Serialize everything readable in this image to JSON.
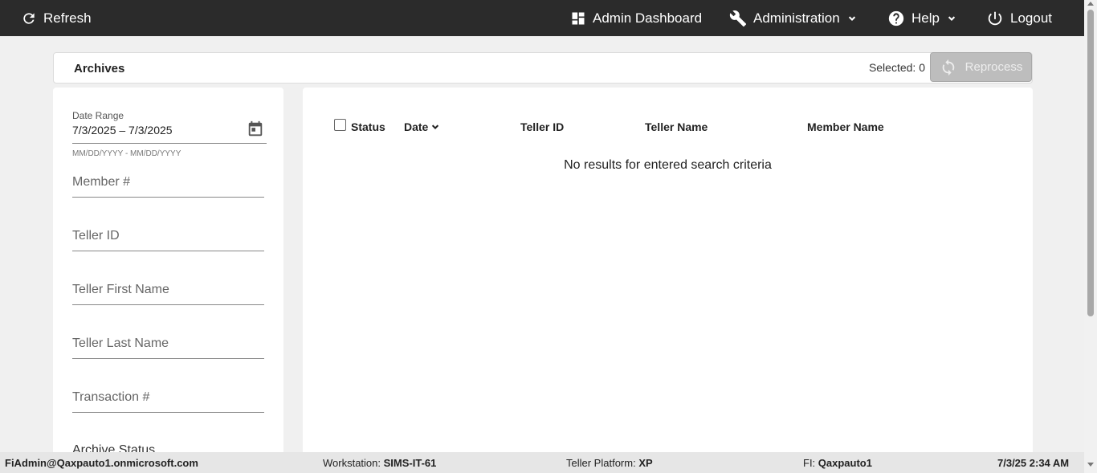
{
  "nav": {
    "refresh": "Refresh",
    "admin_dashboard": "Admin Dashboard",
    "administration": "Administration",
    "help": "Help",
    "logout": "Logout"
  },
  "header": {
    "title": "Archives",
    "selected_label": "Selected: 0",
    "reprocess_label": "Reprocess"
  },
  "filters": {
    "date_range_label": "Date Range",
    "date_range_value": "7/3/2025 – 7/3/2025",
    "date_hint": "MM/DD/YYYY - MM/DD/YYYY",
    "member_placeholder": "Member #",
    "teller_id_placeholder": "Teller ID",
    "teller_first_placeholder": "Teller First Name",
    "teller_last_placeholder": "Teller Last Name",
    "transaction_placeholder": "Transaction #",
    "archive_status_label": "Archive Status"
  },
  "table": {
    "columns": [
      "Status",
      "Date",
      "Teller ID",
      "Teller Name",
      "Member Name"
    ],
    "empty_message": "No results for entered search criteria"
  },
  "footer": {
    "user": "FiAdmin@Qaxpauto1.onmicrosoft.com",
    "workstation_label": "Workstation: ",
    "workstation_value": "SIMS-IT-61",
    "platform_label": "Teller Platform: ",
    "platform_value": "XP",
    "fi_label": "FI: ",
    "fi_value": "Qaxpauto1",
    "datetime": "7/3/25 2:34 AM"
  },
  "icons": {
    "refresh": "refresh-icon",
    "dashboard": "dashboard-icon",
    "wrench": "wrench-icon",
    "help": "help-icon",
    "power": "power-icon",
    "calendar": "calendar-icon",
    "sort": "chevron-down-icon"
  },
  "colors": {
    "navbar": "#2b2b2b",
    "background": "#f0f0f0",
    "reprocess_disabled": "#bdbdbd"
  }
}
